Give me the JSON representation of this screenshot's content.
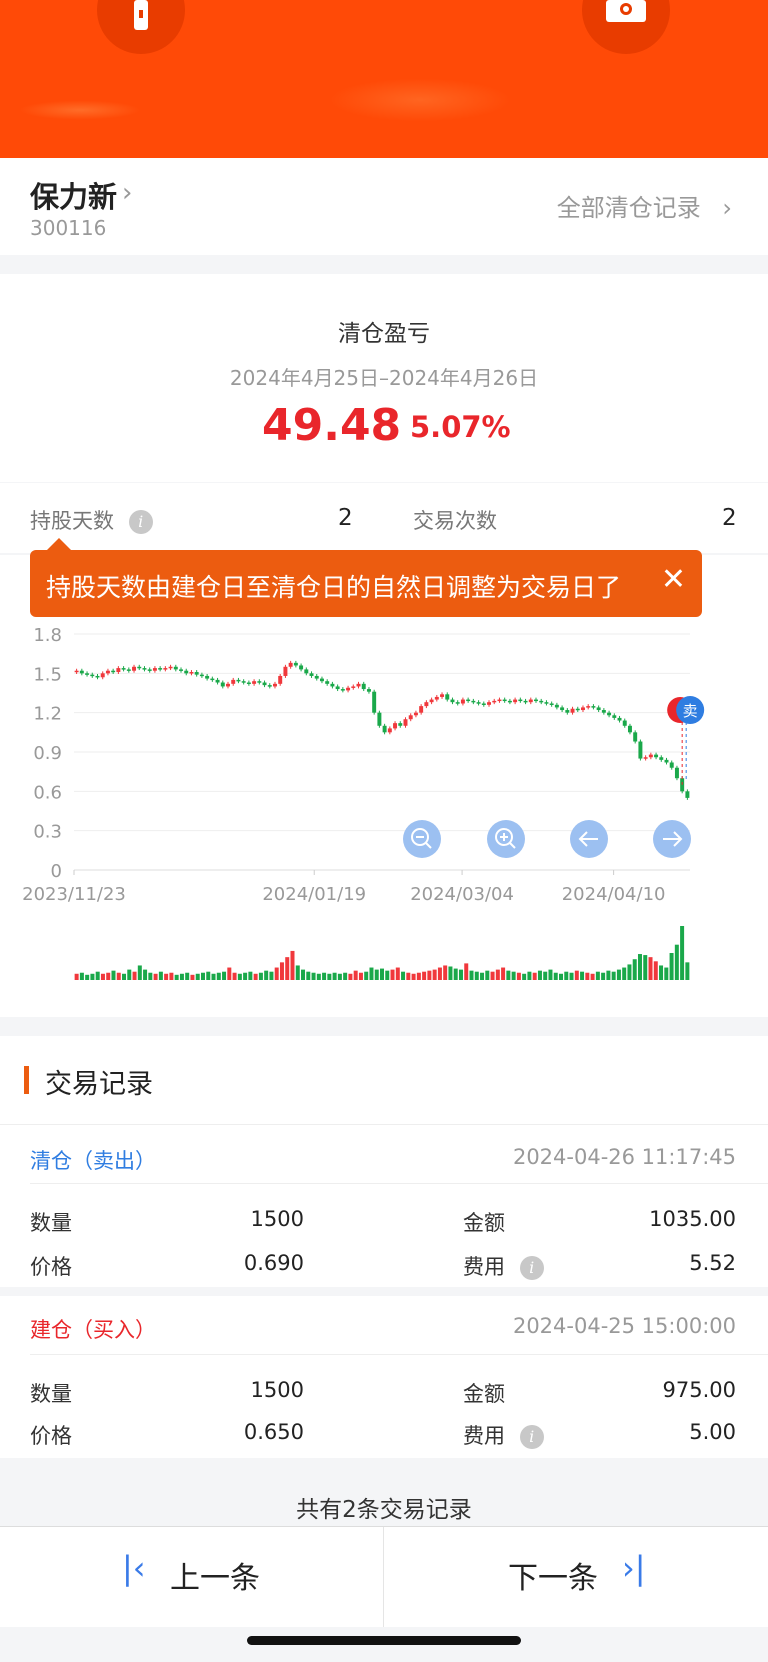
{
  "stock": {
    "name": "保力新",
    "code": "300116",
    "all_records_label": "全部清仓记录"
  },
  "summary": {
    "title": "清仓盈亏",
    "date_range": "2024年4月25日–2024年4月26日",
    "profit": "49.48",
    "profit_pct": "5.07%"
  },
  "stats": {
    "holding_days_label": "持股天数",
    "holding_days_value": "2",
    "trade_count_label": "交易次数",
    "trade_count_value": "2"
  },
  "tooltip": {
    "text": "持股天数由建仓日至清仓日的自然日调整为交易日了"
  },
  "chart_data": {
    "type": "candlestick",
    "y_ticks": [
      "1.8",
      "1.5",
      "1.2",
      "0.9",
      "0.6",
      "0.3",
      "0"
    ],
    "ylim": [
      0,
      1.8
    ],
    "x_ticks": [
      "2023/11/23",
      "2024/01/19",
      "2024/03/04",
      "2024/04/10"
    ],
    "sell_marker": "卖",
    "close_values": [
      1.52,
      1.5,
      1.49,
      1.48,
      1.47,
      1.5,
      1.52,
      1.51,
      1.54,
      1.53,
      1.52,
      1.55,
      1.54,
      1.53,
      1.52,
      1.54,
      1.53,
      1.54,
      1.55,
      1.53,
      1.52,
      1.5,
      1.51,
      1.49,
      1.48,
      1.46,
      1.45,
      1.43,
      1.4,
      1.42,
      1.45,
      1.44,
      1.43,
      1.42,
      1.44,
      1.43,
      1.41,
      1.4,
      1.42,
      1.48,
      1.55,
      1.58,
      1.56,
      1.53,
      1.5,
      1.48,
      1.46,
      1.44,
      1.42,
      1.4,
      1.38,
      1.37,
      1.39,
      1.4,
      1.42,
      1.38,
      1.36,
      1.2,
      1.1,
      1.05,
      1.08,
      1.12,
      1.1,
      1.15,
      1.18,
      1.2,
      1.25,
      1.28,
      1.3,
      1.32,
      1.34,
      1.3,
      1.28,
      1.27,
      1.3,
      1.29,
      1.28,
      1.27,
      1.26,
      1.28,
      1.29,
      1.3,
      1.29,
      1.28,
      1.3,
      1.29,
      1.28,
      1.3,
      1.29,
      1.28,
      1.27,
      1.26,
      1.24,
      1.22,
      1.2,
      1.23,
      1.22,
      1.24,
      1.25,
      1.24,
      1.22,
      1.2,
      1.18,
      1.16,
      1.14,
      1.1,
      1.05,
      0.98,
      0.85,
      0.86,
      0.88,
      0.86,
      0.84,
      0.82,
      0.78,
      0.7,
      0.6,
      0.55
    ],
    "volumes": [
      6,
      7,
      5,
      6,
      8,
      6,
      7,
      9,
      7,
      6,
      10,
      8,
      14,
      10,
      7,
      6,
      8,
      6,
      7,
      5,
      6,
      7,
      5,
      6,
      7,
      8,
      6,
      7,
      8,
      12,
      7,
      6,
      7,
      8,
      6,
      7,
      9,
      8,
      12,
      17,
      22,
      28,
      14,
      10,
      8,
      7,
      6,
      7,
      6,
      7,
      6,
      7,
      6,
      9,
      7,
      8,
      12,
      10,
      11,
      9,
      10,
      12,
      8,
      7,
      6,
      7,
      8,
      9,
      10,
      12,
      14,
      13,
      11,
      10,
      16,
      9,
      8,
      7,
      9,
      8,
      10,
      12,
      9,
      8,
      7,
      6,
      8,
      7,
      9,
      8,
      10,
      7,
      6,
      8,
      7,
      9,
      8,
      7,
      6,
      8,
      7,
      9,
      8,
      10,
      12,
      15,
      20,
      25,
      24,
      22,
      18,
      14,
      12,
      26,
      34,
      52,
      17
    ]
  },
  "chart_controls": {
    "zoom_out": "zoom-out",
    "zoom_in": "zoom-in",
    "prev": "arrow-left",
    "next": "arrow-right"
  },
  "trades": {
    "title": "交易记录",
    "records": [
      {
        "type": "清仓（卖出）",
        "color": "#2f7de1",
        "time": "2024-04-26 11:17:45",
        "qty_label": "数量",
        "qty": "1500",
        "amount_label": "金额",
        "amount": "1035.00",
        "price_label": "价格",
        "price": "0.690",
        "fee_label": "费用",
        "fee": "5.52"
      },
      {
        "type": "建仓（买入）",
        "color": "#e9262b",
        "time": "2024-04-25 15:00:00",
        "qty_label": "数量",
        "qty": "1500",
        "amount_label": "金额",
        "amount": "975.00",
        "price_label": "价格",
        "price": "0.650",
        "fee_label": "费用",
        "fee": "5.00"
      }
    ],
    "count_text": "共有2条交易记录"
  },
  "nav": {
    "prev_label": "上一条",
    "next_label": "下一条"
  },
  "colors": {
    "brand": "#ff4a07",
    "up": "#f0383c",
    "down": "#1aa84a",
    "accent_blue": "#2f7de1"
  }
}
